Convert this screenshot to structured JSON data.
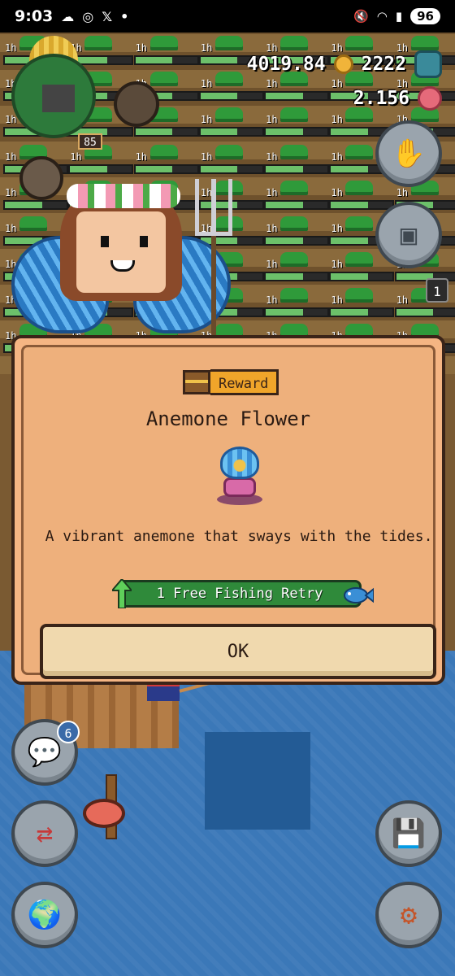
{
  "status_bar": {
    "time": "9:03",
    "battery": "96",
    "icons_left": [
      "cloud-icon",
      "instagram-icon",
      "x-icon",
      "dot-icon"
    ],
    "icons_right": [
      "mute-icon",
      "wifi-icon",
      "signal-icon",
      "battery-icon"
    ]
  },
  "hud": {
    "coins": "4019.84",
    "gems": "2222",
    "flowers": "2.156",
    "player_level": "85"
  },
  "farm": {
    "plot_label": "1h"
  },
  "side_buttons": {
    "chat_badge": "6",
    "queue_badge": "1"
  },
  "modal": {
    "tag": "Reward",
    "title": "Anemone Flower",
    "description": "A vibrant anemone that sways with the tides.",
    "bonus": "1 Free Fishing Retry",
    "ok_label": "OK"
  },
  "colors": {
    "modal_bg": "#eeb07c",
    "reward_tag": "#f0a52a",
    "bonus_pill": "#2f8a3a",
    "water": "#3b78b8"
  }
}
